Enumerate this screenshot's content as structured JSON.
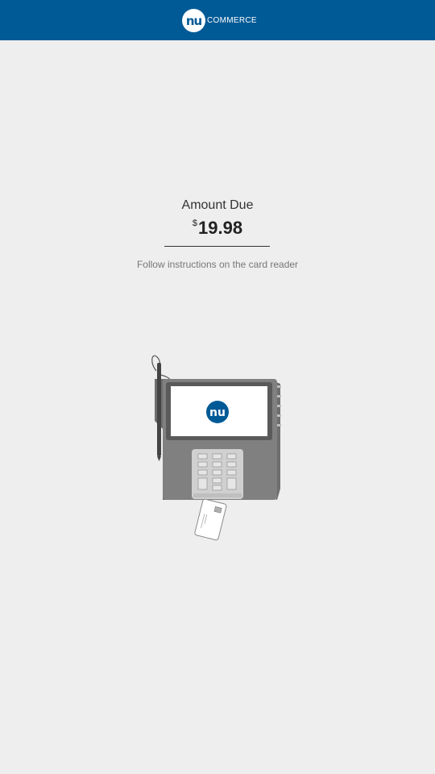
{
  "header": {
    "logo_mark": "nu",
    "logo_word": "COMMERCE"
  },
  "payment": {
    "amount_label": "Amount Due",
    "currency_symbol": "$",
    "amount": "19.98",
    "instruction": "Follow instructions on the card reader"
  },
  "device": {
    "screen_logo": "nu"
  },
  "colors": {
    "header_bg": "#005a96",
    "page_bg": "#eeeeee",
    "device_body": "#808080"
  }
}
